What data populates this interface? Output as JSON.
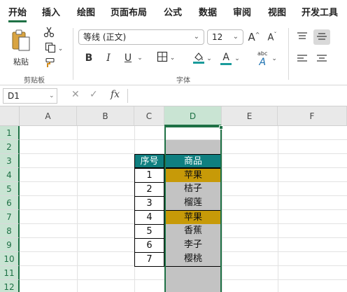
{
  "tabs": [
    {
      "label": "开始",
      "active": true
    },
    {
      "label": "插入"
    },
    {
      "label": "绘图"
    },
    {
      "label": "页面布局"
    },
    {
      "label": "公式"
    },
    {
      "label": "数据"
    },
    {
      "label": "审阅"
    },
    {
      "label": "视图"
    },
    {
      "label": "开发工具"
    }
  ],
  "ribbon": {
    "clipboard": {
      "paste_label": "粘贴",
      "group_label": "剪贴板",
      "icons": [
        "paste-icon",
        "cut-icon",
        "copy-icon",
        "format-painter-icon"
      ]
    },
    "font": {
      "font_name": "等线 (正文)",
      "font_size": "12",
      "grow_label": "A",
      "shrink_label": "A",
      "bold": "B",
      "italic": "I",
      "underline": "U",
      "font_color_label": "A",
      "phonetic_label": "abc",
      "phonetic_letter": "A",
      "group_label": "字体",
      "fill_color": "#1a9b9b",
      "font_color": "#1a9b9b",
      "icons": [
        "borders-icon",
        "fill-color-icon",
        "font-color-icon",
        "phonetic-guide-icon"
      ]
    },
    "alignment": {
      "icons": [
        "align-top-icon",
        "align-middle-icon",
        "align-left-icon",
        "align-center-icon"
      ]
    }
  },
  "formula_bar": {
    "name_box": "D1",
    "cancel_symbol": "✕",
    "enter_symbol": "✓",
    "fx_label": "fx",
    "content": ""
  },
  "sheet": {
    "columns": [
      "A",
      "B",
      "C",
      "D",
      "E",
      "F"
    ],
    "selected_column": "D",
    "rows": [
      "1",
      "2",
      "3",
      "4",
      "5",
      "6",
      "7",
      "8",
      "9",
      "10",
      "11",
      "12"
    ],
    "table": {
      "header_seq": "序号",
      "header_item": "商品",
      "header_color": "#0f7f80",
      "highlight_color": "#c79a08",
      "neutral_color": "#c3c3c3",
      "data": [
        {
          "seq": "1",
          "item": "苹果",
          "highlight": true
        },
        {
          "seq": "2",
          "item": "桔子",
          "highlight": false
        },
        {
          "seq": "3",
          "item": "榴莲",
          "highlight": false
        },
        {
          "seq": "4",
          "item": "苹果",
          "highlight": true
        },
        {
          "seq": "5",
          "item": "香蕉",
          "highlight": false
        },
        {
          "seq": "6",
          "item": "李子",
          "highlight": false
        },
        {
          "seq": "7",
          "item": "樱桃",
          "highlight": false
        }
      ]
    },
    "accent_color": "#1e7145"
  }
}
